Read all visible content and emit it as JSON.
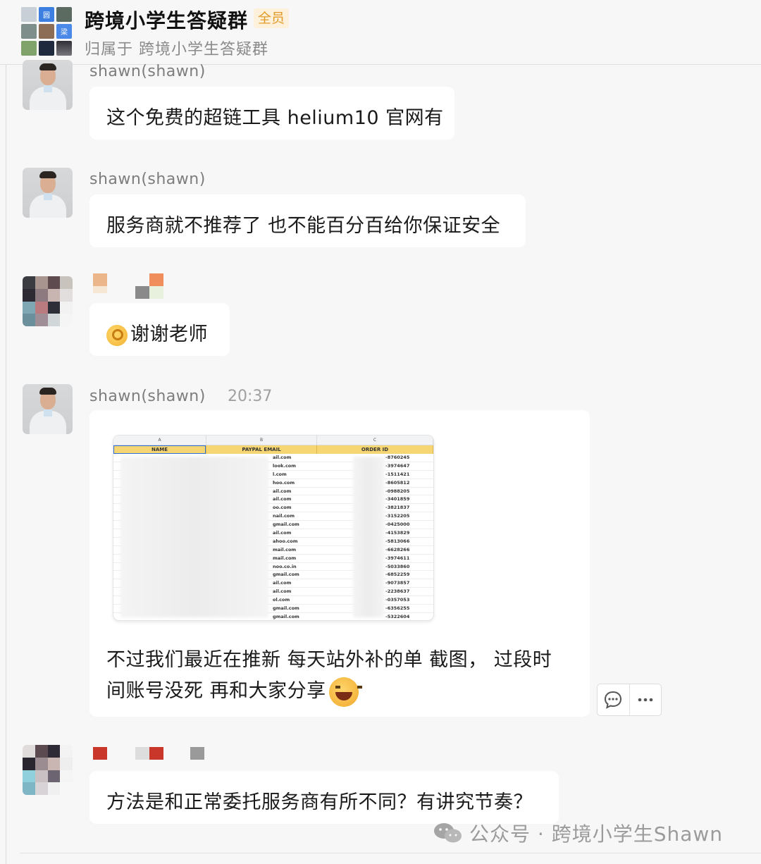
{
  "header": {
    "title": "跨境小学生答疑群",
    "badge": "全员",
    "subtitle": "归属于 跨境小学生答疑群",
    "avatar_tiles": [
      "圆",
      "梁"
    ]
  },
  "messages": [
    {
      "sender": "shawn(shawn)",
      "text": "这个免费的超链工具 helium10 官网有"
    },
    {
      "sender": "shawn(shawn)",
      "text": "服务商就不推荐了 也不能百分百给你保证安全"
    },
    {
      "sender": "",
      "text": "谢谢老师",
      "emoji": "ok-hand-emoji"
    },
    {
      "sender": "shawn(shawn)",
      "time": "20:37",
      "image": {
        "columns": [
          "A",
          "B",
          "C"
        ],
        "headers": [
          "NAME",
          "PAYPAL EMAIL",
          "ORDER ID"
        ],
        "rows": [
          {
            "email": "ail.com",
            "order": "-8760245"
          },
          {
            "email": "look.com",
            "order": "-3974647"
          },
          {
            "email": "l.com",
            "order": "-1511421"
          },
          {
            "email": "hoo.com",
            "order": "-8605812"
          },
          {
            "email": "ail.com",
            "order": "-0988205"
          },
          {
            "email": "ail.com",
            "order": "-3401859"
          },
          {
            "email": "oo.com",
            "order": "-3821837"
          },
          {
            "email": "nail.com",
            "order": "-3152205"
          },
          {
            "email": "gmail.com",
            "order": "-0425000"
          },
          {
            "email": "ail.com",
            "order": "-4153829"
          },
          {
            "email": "ahoo.com",
            "order": "-5813066"
          },
          {
            "email": "mail.com",
            "order": "-6628266"
          },
          {
            "email": "mail.com",
            "order": "-3974611"
          },
          {
            "email": "noo.co.in",
            "order": "-5033860"
          },
          {
            "email": "gmail.com",
            "order": "-6852259"
          },
          {
            "email": "ail.com",
            "order": "-9073857"
          },
          {
            "email": "ail.com",
            "order": "-2238637"
          },
          {
            "email": "ol.com",
            "order": "-0357053"
          },
          {
            "email": "gmail.com",
            "order": "-6356255"
          },
          {
            "email": "gmail.com",
            "order": "-5322604"
          }
        ]
      },
      "text_line1": "不过我们最近在推新 每天站外补的单 截图， 过段时",
      "text_line2": "间账号没死 再和大家分享",
      "emoji": "laughing-emoji"
    },
    {
      "sender": "",
      "text": "方法是和正常委托服务商有所不同？有讲究节奏？"
    }
  ],
  "actions": {
    "comment_icon": "comment-icon",
    "more_icon": "more-icon"
  },
  "watermark": "公众号 · 跨境小学生Shawn"
}
